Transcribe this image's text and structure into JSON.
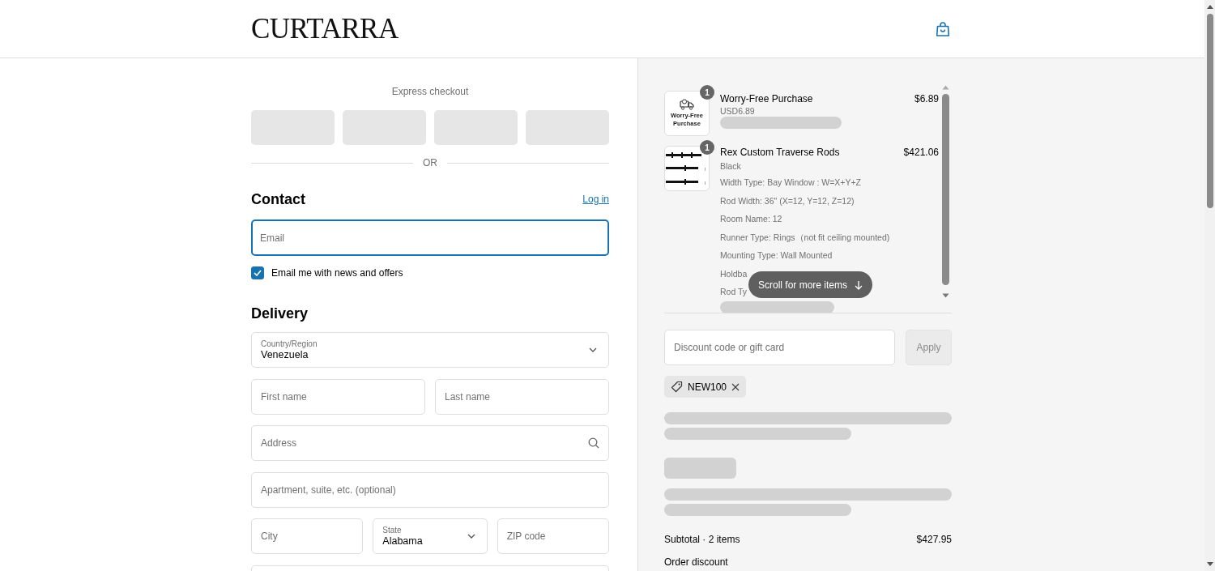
{
  "header": {
    "logo": "CURTARRA"
  },
  "express_checkout": {
    "title": "Express checkout",
    "separator": "OR"
  },
  "contact": {
    "title": "Contact",
    "login_link": "Log in",
    "email": {
      "placeholder": "Email"
    },
    "newsletter": {
      "label": "Email me with news and offers",
      "checked": true
    }
  },
  "delivery": {
    "title": "Delivery",
    "rows": [
      {
        "fields": [
          {
            "kind": "select",
            "label": "Country/Region",
            "value": "Venezuela"
          }
        ]
      },
      {
        "fields": [
          {
            "kind": "text",
            "placeholder": "First name"
          },
          {
            "kind": "text",
            "placeholder": "Last name"
          }
        ]
      },
      {
        "fields": [
          {
            "kind": "search",
            "placeholder": "Address"
          }
        ]
      },
      {
        "fields": [
          {
            "kind": "text",
            "placeholder": "Apartment, suite, etc. (optional)"
          }
        ]
      },
      {
        "fields": [
          {
            "kind": "text",
            "placeholder": "City"
          },
          {
            "kind": "select",
            "label": "State",
            "value": "Alabama"
          },
          {
            "kind": "text",
            "placeholder": "ZIP code"
          }
        ]
      }
    ]
  },
  "order": {
    "items": [
      {
        "kind": "service",
        "thumbnail_text": "Worry-Free Purchase",
        "quantity": "1",
        "name": "Worry-Free Purchase",
        "price": "$6.89",
        "subtitle": "USD6.89"
      },
      {
        "kind": "product",
        "quantity": "1",
        "name": "Rex Custom Traverse Rods",
        "price": "$421.06",
        "subtitle": "Black",
        "details": [
          "Width Type: Bay Window : W=X+Y+Z",
          "Rod Width: 36\" (X=12, Y=12, Z=12)",
          "Room Name: 12",
          "Runner Type: Rings（not fit ceiling mounted)",
          "Mounting Type: Wall Mounted",
          "Holdba",
          "Rod Ty"
        ]
      }
    ],
    "scroll_hint": "Scroll for more items"
  },
  "discount": {
    "placeholder": "Discount code or gift card",
    "apply_button": {
      "label": "Apply",
      "disabled": true
    },
    "applied_code": "NEW100"
  },
  "summary": [
    {
      "label": "Subtotal · 2 items",
      "value": "$427.95"
    },
    {
      "label": "Order discount"
    }
  ]
}
